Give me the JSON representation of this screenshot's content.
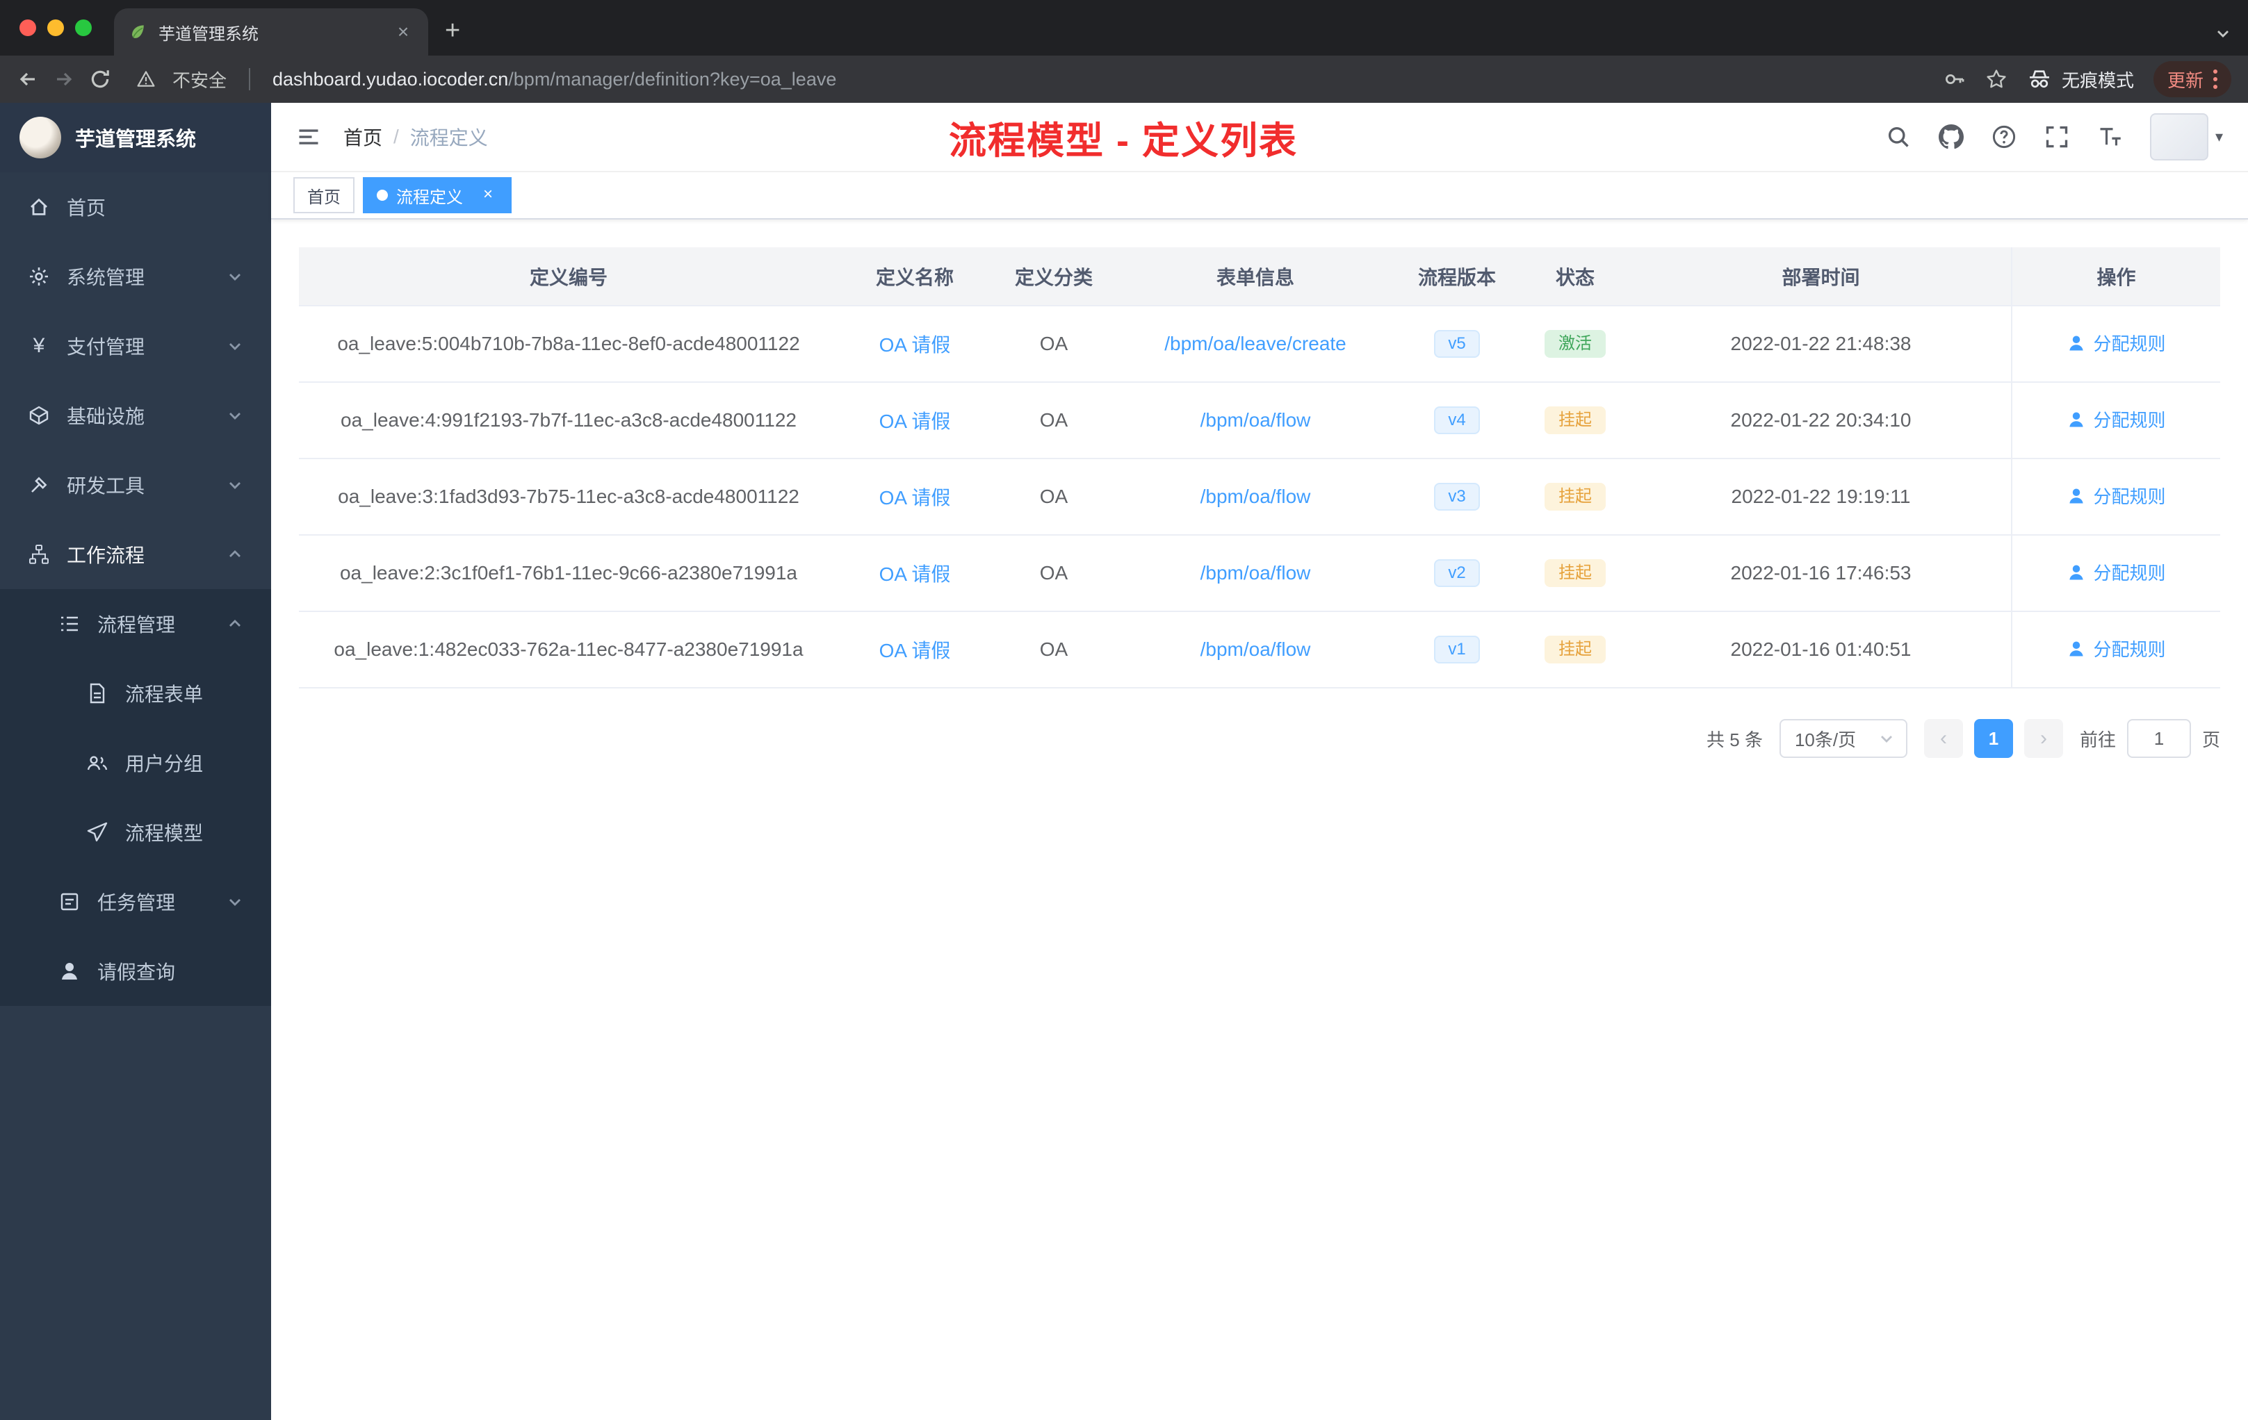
{
  "browser": {
    "tab_title": "芋道管理系统",
    "security_label": "不安全",
    "url_host": "dashboard.yudao.iocoder.cn",
    "url_path": "/bpm/manager/definition?key=oa_leave",
    "incognito_label": "无痕模式",
    "update_label": "更新"
  },
  "sidebar": {
    "logo_title": "芋道管理系统",
    "items": [
      {
        "label": "首页"
      },
      {
        "label": "系统管理"
      },
      {
        "label": "支付管理"
      },
      {
        "label": "基础设施"
      },
      {
        "label": "研发工具"
      },
      {
        "label": "工作流程"
      },
      {
        "label": "流程管理"
      },
      {
        "label": "流程表单"
      },
      {
        "label": "用户分组"
      },
      {
        "label": "流程模型"
      },
      {
        "label": "任务管理"
      },
      {
        "label": "请假查询"
      }
    ]
  },
  "header": {
    "breadcrumb": [
      "首页",
      "流程定义"
    ],
    "separator": "/",
    "page_title": "流程模型 - 定义列表"
  },
  "tags": {
    "home": "首页",
    "active": "流程定义"
  },
  "table": {
    "columns": [
      "定义编号",
      "定义名称",
      "定义分类",
      "表单信息",
      "流程版本",
      "状态",
      "部署时间",
      "操作"
    ],
    "action_label": "分配规则",
    "rows": [
      {
        "id": "oa_leave:5:004b710b-7b8a-11ec-8ef0-acde48001122",
        "name": "OA 请假",
        "category": "OA",
        "form": "/bpm/oa/leave/create",
        "version": "v5",
        "status": "激活",
        "time": "2022-01-22 21:48:38"
      },
      {
        "id": "oa_leave:4:991f2193-7b7f-11ec-a3c8-acde48001122",
        "name": "OA 请假",
        "category": "OA",
        "form": "/bpm/oa/flow",
        "version": "v4",
        "status": "挂起",
        "time": "2022-01-22 20:34:10"
      },
      {
        "id": "oa_leave:3:1fad3d93-7b75-11ec-a3c8-acde48001122",
        "name": "OA 请假",
        "category": "OA",
        "form": "/bpm/oa/flow",
        "version": "v3",
        "status": "挂起",
        "time": "2022-01-22 19:19:11"
      },
      {
        "id": "oa_leave:2:3c1f0ef1-76b1-11ec-9c66-a2380e71991a",
        "name": "OA 请假",
        "category": "OA",
        "form": "/bpm/oa/flow",
        "version": "v2",
        "status": "挂起",
        "time": "2022-01-16 17:46:53"
      },
      {
        "id": "oa_leave:1:482ec033-762a-11ec-8477-a2380e71991a",
        "name": "OA 请假",
        "category": "OA",
        "form": "/bpm/oa/flow",
        "version": "v1",
        "status": "挂起",
        "time": "2022-01-16 01:40:51"
      }
    ]
  },
  "pagination": {
    "total": "共 5 条",
    "page_size": "10条/页",
    "current_page": "1",
    "goto_label": "前往",
    "goto_value": "1",
    "page_unit": "页"
  },
  "colors": {
    "accent": "#409eff",
    "title_red": "#f12d2d",
    "status_active": "#3ea65a",
    "status_suspended": "#e6a23c"
  }
}
